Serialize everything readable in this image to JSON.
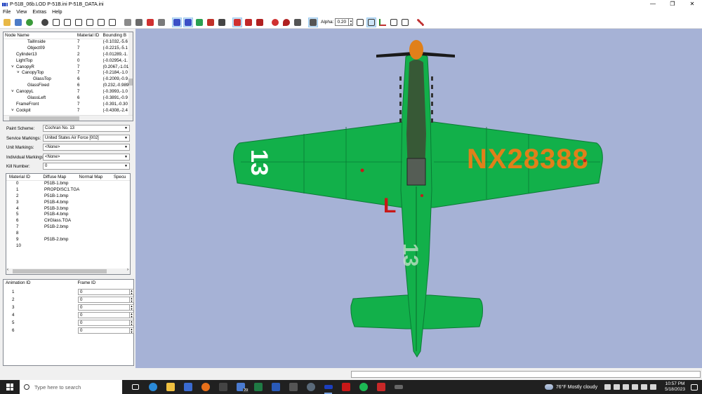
{
  "window": {
    "title": "P-51B_06b.LOD  P-51B.ini  P-51B_DATA.ini",
    "minimize": "—",
    "maximize": "❐",
    "close": "✕"
  },
  "menu": [
    "File",
    "View",
    "Extras",
    "Help"
  ],
  "toolbar": {
    "alpha_label": "Alpha:",
    "alpha_value": "0.20"
  },
  "tree": {
    "headers": [
      "Node Name",
      "Material ID",
      "Bounding B"
    ],
    "rows": [
      {
        "name": "TailInside",
        "indent": 4,
        "mat": "7",
        "bb": "(-0.1032,-5.6"
      },
      {
        "name": "Object09",
        "indent": 4,
        "mat": "7",
        "bb": "(-0.2215,-5.1"
      },
      {
        "name": "Cylinder13",
        "indent": 2,
        "mat": "2",
        "bb": "(-0.01289,-1."
      },
      {
        "name": "LightTop",
        "indent": 2,
        "mat": "0",
        "bb": "(-0.02954,-1."
      },
      {
        "name": "CanopyR",
        "indent": 2,
        "mat": "7",
        "bb": "(0.2067,-1.01",
        "expander": "˅"
      },
      {
        "name": "CanopyTop",
        "indent": 3,
        "mat": "7",
        "bb": "(-0.2184,-1.0",
        "expander": "˅"
      },
      {
        "name": "GlassTop",
        "indent": 5,
        "mat": "6",
        "bb": "(-0.2009,-0.9"
      },
      {
        "name": "GlassFixed",
        "indent": 4,
        "mat": "6",
        "bb": "(0.232,-0.989"
      },
      {
        "name": "CanopyL",
        "indent": 2,
        "mat": "7",
        "bb": "(-0.3993,-1.0",
        "expander": "˅"
      },
      {
        "name": "GlassLeft",
        "indent": 4,
        "mat": "6",
        "bb": "(-0.3891,-0.9"
      },
      {
        "name": "FrameFront",
        "indent": 2,
        "mat": "7",
        "bb": "(-0.391,-0.30"
      },
      {
        "name": "Cockpit",
        "indent": 2,
        "mat": "7",
        "bb": "(-0.4308,-2.4",
        "expander": "˅"
      }
    ]
  },
  "form": {
    "paint_scheme": {
      "label": "Paint Scheme:",
      "value": "Cochran No. 13"
    },
    "service_markings": {
      "label": "Service Markings:",
      "value": "United States Air Force [002]"
    },
    "unit_markings": {
      "label": "Unit Markings:",
      "value": "<None>"
    },
    "individual_markings": {
      "label": "Individual Markings:",
      "value": "<None>"
    },
    "kill_number": {
      "label": "Kill Number:",
      "value": "0"
    }
  },
  "materials": {
    "headers": [
      "Material ID",
      "Diffuse Map",
      "Normal Map",
      "Specu"
    ],
    "rows": [
      {
        "id": "0",
        "diffuse": "P51B-1.bmp"
      },
      {
        "id": "1",
        "diffuse": "PROPDISC1.TGA"
      },
      {
        "id": "2",
        "diffuse": "P51B-1.bmp"
      },
      {
        "id": "3",
        "diffuse": "P51B-4.bmp"
      },
      {
        "id": "4",
        "diffuse": "P51B-3.bmp"
      },
      {
        "id": "5",
        "diffuse": "P51B-4.bmp"
      },
      {
        "id": "6",
        "diffuse": "ClrGlass.TGA"
      },
      {
        "id": "7",
        "diffuse": "P51B-2.bmp"
      },
      {
        "id": "8",
        "diffuse": ""
      },
      {
        "id": "9",
        "diffuse": "P51B-2.bmp"
      },
      {
        "id": "10",
        "diffuse": ""
      }
    ]
  },
  "animation": {
    "headers": [
      "Animation ID",
      "Frame ID"
    ],
    "rows": [
      {
        "id": "1",
        "frame": "0"
      },
      {
        "id": "2",
        "frame": "0"
      },
      {
        "id": "3",
        "frame": "0"
      },
      {
        "id": "4",
        "frame": "0"
      },
      {
        "id": "5",
        "frame": "0"
      },
      {
        "id": "6",
        "frame": "0"
      }
    ]
  },
  "aircraft": {
    "registration": "NX28388",
    "race_number": "13",
    "tail_letter": "L",
    "body_color": "#12b04a",
    "marking_color": "#e0801a",
    "background": "#a6b2d6"
  },
  "taskbar": {
    "search_placeholder": "Type here to search",
    "mail_badge": "29",
    "weather": "76°F  Mostly cloudy",
    "time": "10:57 PM",
    "date": "5/18/2023"
  }
}
